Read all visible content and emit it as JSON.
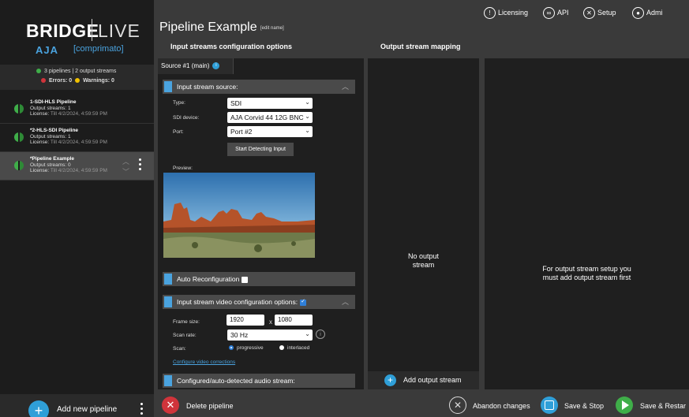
{
  "brand": {
    "name": "BRIDGE",
    "live": "LIVE",
    "aja": "AJA",
    "comprimato": "[comprimato]"
  },
  "summary": {
    "pipelines": "3 pipelines | 2 output streams",
    "errors": "Errors: 0",
    "warnings": "Warnings: 0"
  },
  "pipelines": [
    {
      "name": "1-SDI-HLS Pipeline",
      "outputs": "Output streams: 1",
      "license_label": "License:",
      "license_value": "Till 4/2/2024, 4:59:59 PM"
    },
    {
      "name": "*2-HLS-SDI Pipeline",
      "outputs": "Output streams: 1",
      "license_label": "License:",
      "license_value": "Till 4/2/2024, 4:59:59 PM"
    },
    {
      "name": "*Pipeline Example",
      "outputs": "Output streams: 0",
      "license_label": "License:",
      "license_value": "Till 4/2/2024, 4:59:59 PM"
    }
  ],
  "sidebar_footer": {
    "add_pipeline": "Add new pipeline"
  },
  "header": {
    "title": "Pipeline Example",
    "edit_name": "[edit name]"
  },
  "topnav": {
    "licensing": "Licensing",
    "api": "API",
    "setup": "Setup",
    "admin": "Admi"
  },
  "sections": {
    "input": "Input streams configuration options",
    "output": "Output stream mapping"
  },
  "input": {
    "tab": "Source #1 (main)",
    "source_bar": "Input stream source:",
    "type_label": "Type:",
    "type_value": "SDI",
    "device_label": "SDI device:",
    "device_value": "AJA Corvid 44 12G BNC",
    "port_label": "Port:",
    "port_value": "Port #2",
    "detect_button": "Start Detecting Input",
    "preview_label": "Preview:",
    "auto_reconfig": "Auto Reconfiguration",
    "video_options_bar": "Input stream video configuration options:",
    "frame_label": "Frame size:",
    "frame_w": "1920",
    "frame_x": "x",
    "frame_h": "1080",
    "scanrate_label": "Scan rate:",
    "scanrate_value": "30 Hz",
    "scan_label": "Scan:",
    "scan_progressive": "progressive",
    "scan_interlaced": "interlaced",
    "config_link": "Configure video corrections",
    "audio_bar": "Configured/auto-detected audio stream:"
  },
  "output": {
    "no_output_1": "No output",
    "no_output_2": "stream",
    "add_output": "Add output stream",
    "msg_1": "For output stream setup you",
    "msg_2": "must add output stream first"
  },
  "bottom": {
    "delete": "Delete pipeline",
    "abandon": "Abandon changes",
    "save_stop": "Save & Stop",
    "save_restart": "Save & Restar"
  },
  "colors": {
    "accent": "#2f9fd8",
    "danger": "#d0343b",
    "success": "#3fae49",
    "panel": "#1f1f1f"
  }
}
